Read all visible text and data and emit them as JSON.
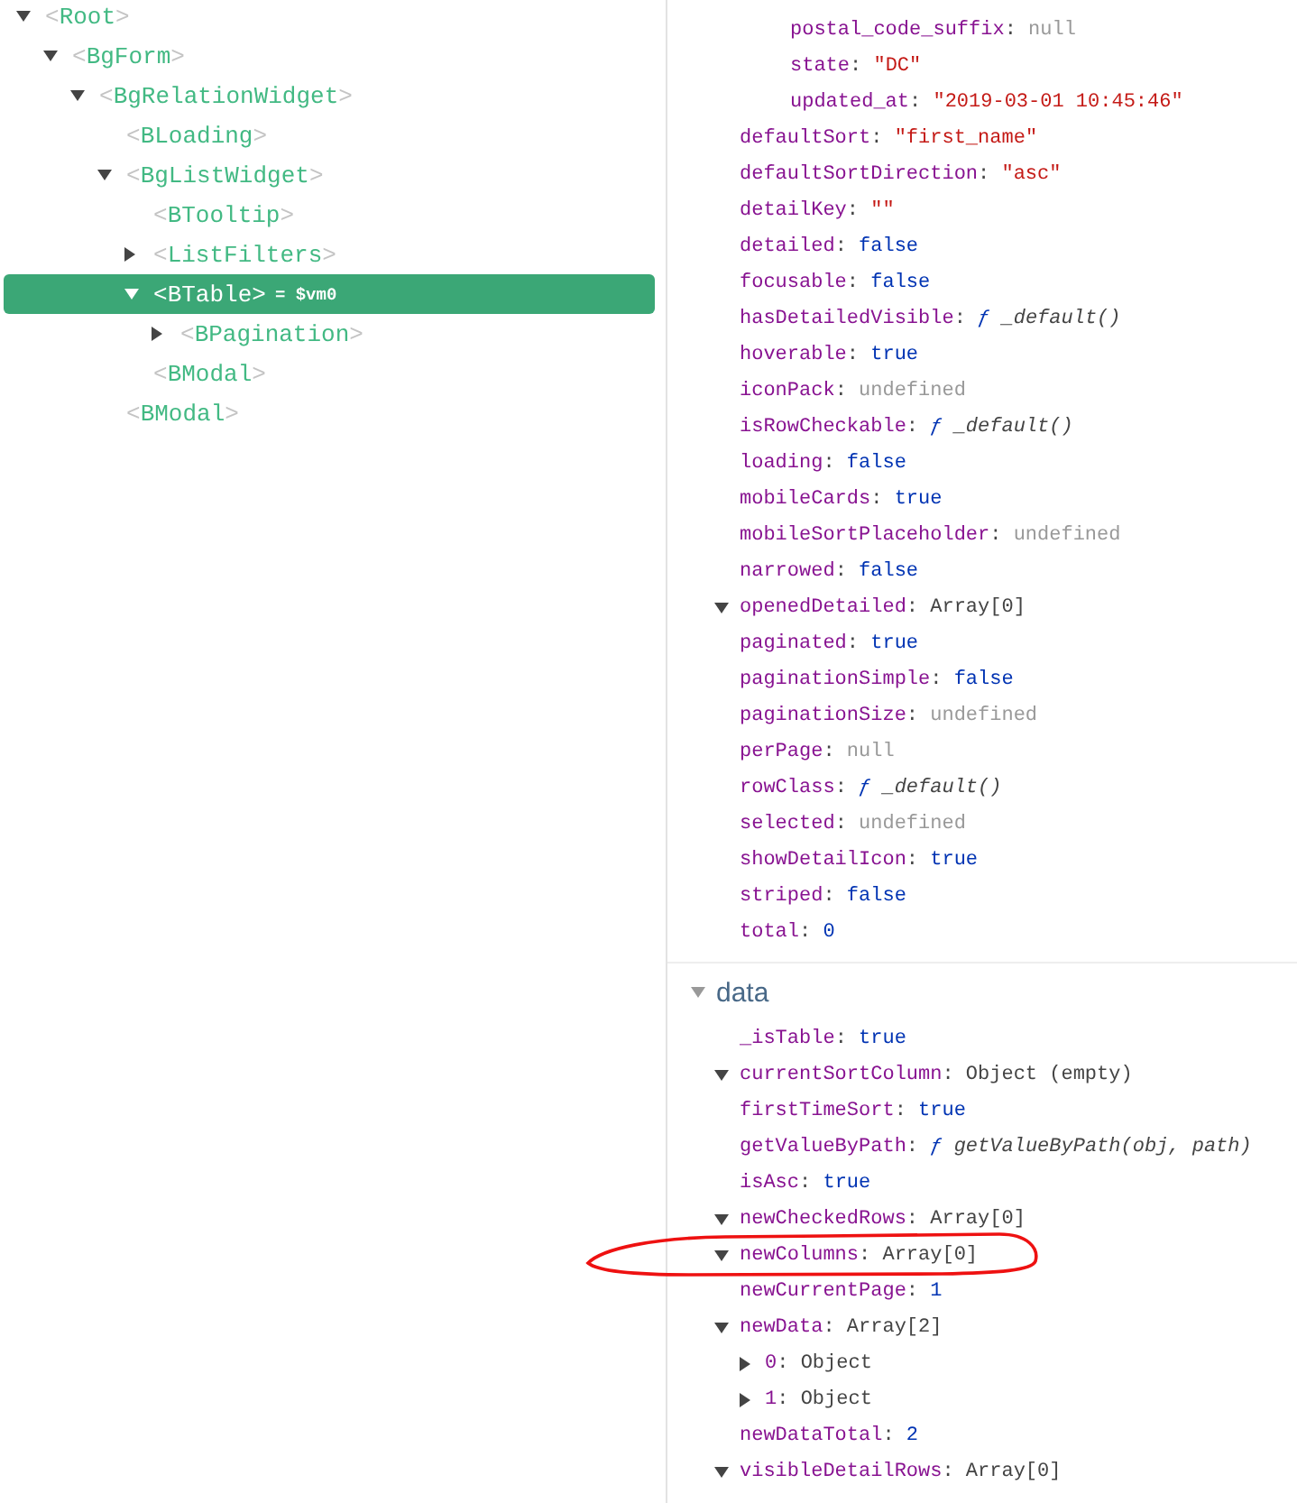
{
  "tree": [
    {
      "label": "<Root>",
      "expanded": true,
      "selected": false,
      "children": [
        {
          "label": "<BgForm>",
          "expanded": true,
          "selected": false,
          "children": [
            {
              "label": "<BgRelationWidget>",
              "expanded": true,
              "selected": false,
              "children": [
                {
                  "label": "<BLoading>",
                  "selected": false
                },
                {
                  "label": "<BgListWidget>",
                  "expanded": true,
                  "selected": false,
                  "children": [
                    {
                      "label": "<BTooltip>",
                      "selected": false
                    },
                    {
                      "label": "<ListFilters>",
                      "expanded": false,
                      "selected": false
                    },
                    {
                      "label": "<BTable>",
                      "expanded": true,
                      "selected": true,
                      "ref": "= $vm0",
                      "children": [
                        {
                          "label": "<BPagination>",
                          "expanded": false,
                          "selected": false
                        }
                      ]
                    },
                    {
                      "label": "<BModal>",
                      "selected": false
                    }
                  ]
                },
                {
                  "label": "<BModal>",
                  "selected": false
                }
              ]
            }
          ]
        }
      ]
    }
  ],
  "inspector": {
    "sections": [
      {
        "rows": [
          {
            "children": [
              {
                "children": [
                  {
                    "key": "postal_code_suffix:",
                    "value": "null",
                    "kind": "empty",
                    "circled": false
                  },
                  {
                    "key": "state:",
                    "value": "\"DC\"",
                    "kind": "string",
                    "circled": false
                  },
                  {
                    "key": "updated_at:",
                    "value": "\"2019-03-01 10:45:46\"",
                    "kind": "string",
                    "circled": false
                  }
                ]
              }
            ]
          },
          {
            "key": "defaultSort:",
            "value": "\"first_name\"",
            "kind": "string",
            "circled": false
          },
          {
            "key": "defaultSortDirection:",
            "value": "\"asc\"",
            "kind": "string",
            "circled": false
          },
          {
            "key": "detailKey:",
            "value": "\"\"",
            "kind": "string",
            "circled": false
          },
          {
            "key": "detailed:",
            "value": "false",
            "kind": "literal",
            "circled": false
          },
          {
            "key": "focusable:",
            "value": "false",
            "kind": "literal",
            "circled": false
          },
          {
            "key": "hasDetailedVisible:",
            "value": "ƒ _default()",
            "kind": "function",
            "circled": false
          },
          {
            "key": "hoverable:",
            "value": "true",
            "kind": "literal",
            "circled": false
          },
          {
            "key": "iconPack:",
            "value": "undefined",
            "kind": "empty",
            "circled": false
          },
          {
            "key": "isRowCheckable:",
            "value": "ƒ _default()",
            "kind": "function",
            "circled": false
          },
          {
            "key": "loading:",
            "value": "false",
            "kind": "literal",
            "circled": false
          },
          {
            "key": "mobileCards:",
            "value": "true",
            "kind": "literal",
            "circled": false
          },
          {
            "key": "mobileSortPlaceholder:",
            "value": "undefined",
            "kind": "empty",
            "circled": false
          },
          {
            "key": "narrowed:",
            "value": "false",
            "kind": "literal",
            "circled": false
          },
          {
            "key": "openedDetailed:",
            "value": "Array[0]",
            "kind": "object",
            "expanded": true,
            "circled": false
          },
          {
            "key": "paginated:",
            "value": "true",
            "kind": "literal",
            "circled": false
          },
          {
            "key": "paginationSimple:",
            "value": "false",
            "kind": "literal",
            "circled": false
          },
          {
            "key": "paginationSize:",
            "value": "undefined",
            "kind": "empty",
            "circled": false
          },
          {
            "key": "perPage:",
            "value": "null",
            "kind": "empty",
            "circled": false
          },
          {
            "key": "rowClass:",
            "value": "ƒ _default()",
            "kind": "function",
            "circled": false
          },
          {
            "key": "selected:",
            "value": "undefined",
            "kind": "empty",
            "circled": false
          },
          {
            "key": "showDetailIcon:",
            "value": "true",
            "kind": "literal",
            "circled": false
          },
          {
            "key": "striped:",
            "value": "false",
            "kind": "literal",
            "circled": false
          },
          {
            "key": "total:",
            "value": "0",
            "kind": "literal",
            "circled": false
          }
        ]
      },
      {
        "title": "data",
        "expanded": true,
        "rows": [
          {
            "key": "_isTable:",
            "value": "true",
            "kind": "literal",
            "circled": false
          },
          {
            "key": "currentSortColumn:",
            "value": "Object (empty)",
            "kind": "object",
            "expanded": true,
            "circled": false
          },
          {
            "key": "firstTimeSort:",
            "value": "true",
            "kind": "literal",
            "circled": false
          },
          {
            "key": "getValueByPath:",
            "value": "ƒ getValueByPath(obj, path)",
            "kind": "function",
            "circled": false
          },
          {
            "key": "isAsc:",
            "value": "true",
            "kind": "literal",
            "circled": false
          },
          {
            "key": "newCheckedRows:",
            "value": "Array[0]",
            "kind": "object",
            "expanded": true,
            "circled": false
          },
          {
            "key": "newColumns:",
            "value": "Array[0]",
            "kind": "object",
            "expanded": true,
            "circled": true
          },
          {
            "key": "newCurrentPage:",
            "value": "1",
            "kind": "literal",
            "circled": false
          },
          {
            "key": "newData:",
            "value": "Array[2]",
            "kind": "object",
            "expanded": true,
            "circled": false,
            "children": [
              {
                "key": "0:",
                "value": "Object",
                "kind": "object",
                "expanded": false,
                "circled": false
              },
              {
                "key": "1:",
                "value": "Object",
                "kind": "object",
                "expanded": false,
                "circled": false
              }
            ]
          },
          {
            "key": "newDataTotal:",
            "value": "2",
            "kind": "literal",
            "circled": false
          },
          {
            "key": "visibleDetailRows:",
            "value": "Array[0]",
            "kind": "object",
            "expanded": true,
            "circled": false
          }
        ]
      }
    ]
  }
}
